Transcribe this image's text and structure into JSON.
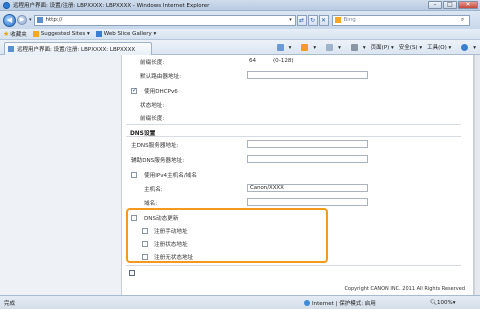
{
  "window": {
    "title": "远程用户界面: 设置/注册: LBPXXXX: LBPXXXX - Windows Internet Explorer",
    "minimize": "–",
    "maximize": "□",
    "close": "✕"
  },
  "address_bar": {
    "back": "◀",
    "forward": "▶",
    "url": "http://",
    "dropdown": "▾",
    "refresh": "↻",
    "stop": "✕",
    "compat": "⇄"
  },
  "search": {
    "placeholder": "Bing",
    "go": "⌕"
  },
  "favorites_bar": {
    "favorites_label": "收藏夹",
    "suggested_sites": "Suggested Sites ▾",
    "web_slice_gallery": "Web Slice Gallery ▾"
  },
  "tab": {
    "label": "远程用户界面: 设置/注册: LBPXXXX: LBPXXXX"
  },
  "command_bar": {
    "home": "▾",
    "feeds": "▾",
    "mail": "▾",
    "print": "▾",
    "page": "页面(P) ▾",
    "safety": "安全(S) ▾",
    "tools": "工具(O) ▾",
    "help": "▾"
  },
  "form": {
    "prefix_length_label": "前缀长度:",
    "prefix_length_value": "64",
    "prefix_length_range": "(0-128)",
    "default_router_label": "默认路由器地址:",
    "default_router_value": "",
    "use_dhcpv6_label": "使用DHCPv6",
    "stateful_address_label": "状态地址:",
    "stateful_prefix_label": "前缀长度:",
    "dns_section_title": "DNS设置",
    "primary_dns_label": "主DNS服务器地址:",
    "primary_dns_value": "",
    "secondary_dns_label": "辅助DNS服务器地址:",
    "secondary_dns_value": "",
    "use_ipv4_host_label": "使用IPv4主机名/域名",
    "host_name_label": "主机名:",
    "host_name_value": "Canon/XXXX",
    "domain_name_label": "域名:",
    "domain_name_value": "",
    "dns_dynamic_update_label": "DNS动态更新",
    "register_manual_label": "注册手动地址",
    "register_stateless_label": "注册状态地址",
    "register_stateful_label": "注册无状态地址"
  },
  "footer": {
    "copyright": "Copyright CANON INC. 2011 All Rights Reserved"
  },
  "status_bar": {
    "left_text": "完成",
    "zone_text": "Internet | 保护模式: 启用",
    "zoom": "100%"
  }
}
